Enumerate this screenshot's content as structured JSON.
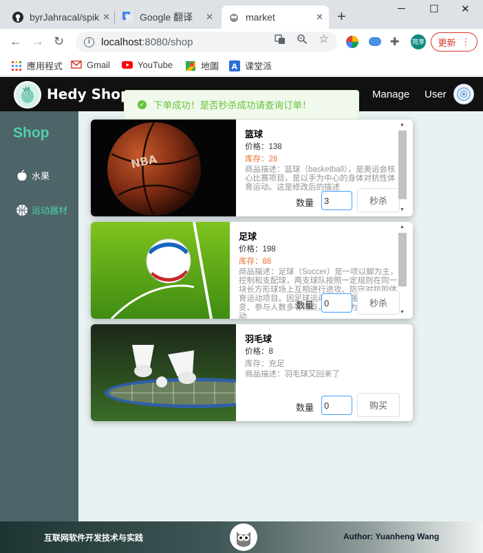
{
  "browser": {
    "tabs": [
      {
        "title": "byrJahracal/spik"
      },
      {
        "title": "Google 翻译"
      },
      {
        "title": "market"
      }
    ],
    "url_host": "localhost",
    "url_path": ":8080/shop",
    "profile_label": "苑享",
    "update_label": "更新",
    "bookmarks": [
      "應用程式",
      "Gmail",
      "YouTube",
      "地圖",
      "课堂派"
    ]
  },
  "header": {
    "brand": "Hedy Shop",
    "nav": [
      "Manage",
      "User"
    ]
  },
  "toast": {
    "message": "下单成功！是否秒杀成功请查询订单！"
  },
  "sidebar": {
    "title": "Shop",
    "items": [
      "水果",
      "运动器材"
    ]
  },
  "products": [
    {
      "name": "篮球",
      "price": "价格：138",
      "stock": "库存：28",
      "desc": "商品描述：篮球（basketball），是奥运会核心比赛项目，是以手为中心的身体对抗性体育运动。这是修改后的描述",
      "qty_label": "数量",
      "qty": "3",
      "action": "秒杀"
    },
    {
      "name": "足球",
      "price": "价格：198",
      "stock": "库存：88",
      "desc": "商品描述：足球（Soccer）是一项以脚为主，控制和支配球，两支球队按照一定规则在同一块长方形球场上互相进行进攻、防守对抗的体育运动项目。因足球运动对抗性强、战术多变、参与人数多等特点，故被称为世界第一运动",
      "qty_label": "数量",
      "qty": "0",
      "action": "秒杀"
    },
    {
      "name": "羽毛球",
      "price": "价格：8",
      "stock": "库存：充足",
      "desc": "商品描述：羽毛球又回来了",
      "qty_label": "数量",
      "qty": "0",
      "action": "购买"
    }
  ],
  "footer": {
    "left": "互联网软件开发技术与实践",
    "right": "Author: Yuanheng Wang"
  },
  "colors": {
    "accent": "#4fd1a9",
    "sidebar_bg": "#4d6468",
    "header_bg": "#111111",
    "stock_orange": "#e6702e",
    "success": "#67c23a",
    "input_border": "#409eff"
  }
}
